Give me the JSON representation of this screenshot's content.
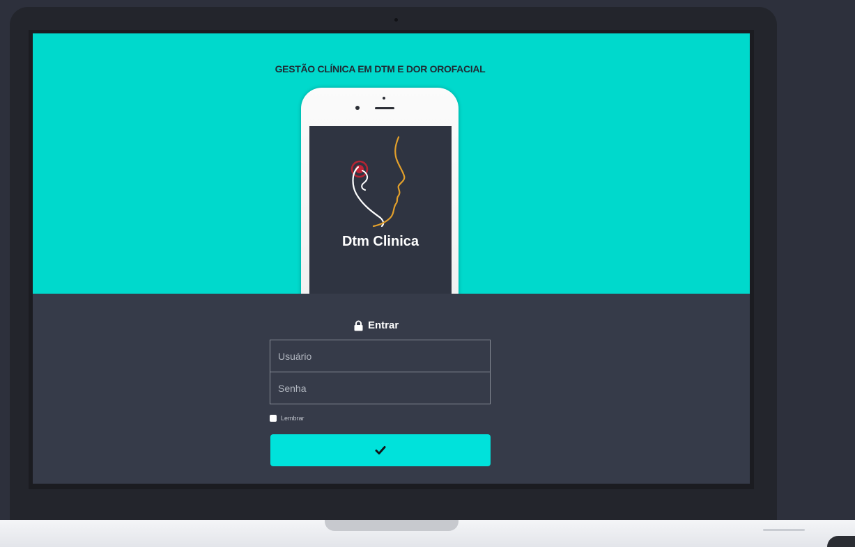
{
  "hero": {
    "title": "GESTÃO CLÍNICA EM DTM E DOR OROFACIAL",
    "app_name": "Dtm Clinica",
    "logo_icon": "face-profile-logo-icon",
    "background": "#00d9cc"
  },
  "login": {
    "heading": "Entrar",
    "heading_icon": "lock-icon",
    "username_placeholder": "Usuário",
    "password_placeholder": "Senha",
    "remember_label": "Lembrar",
    "submit_icon": "check-icon",
    "submit_color": "#00e2db",
    "background": "#363b49"
  }
}
